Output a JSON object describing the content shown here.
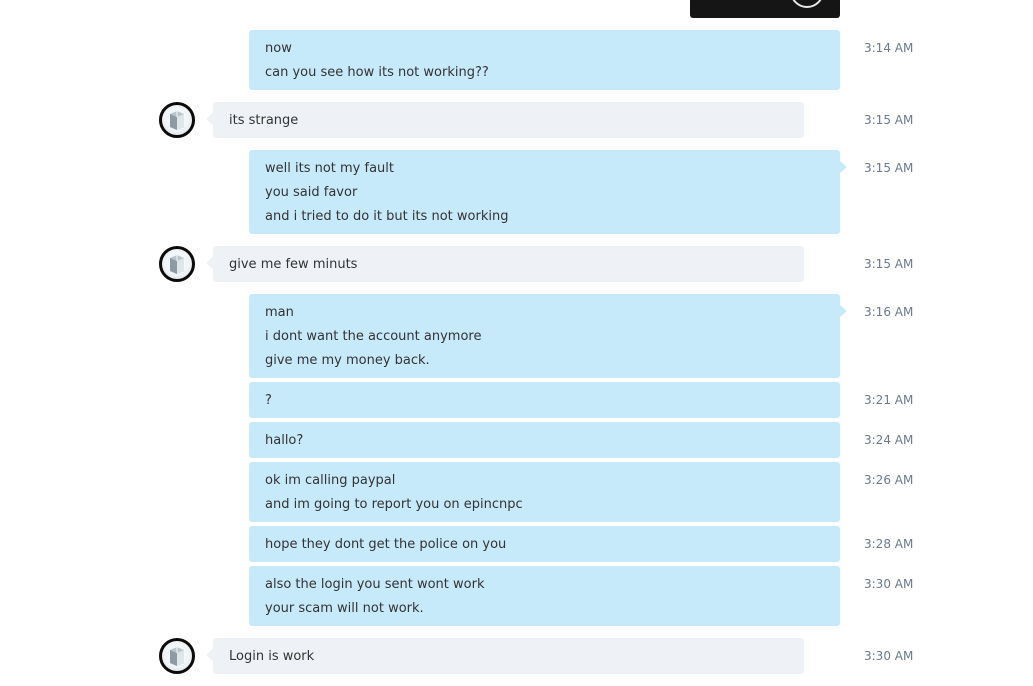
{
  "messages": [
    {
      "id": "m1",
      "direction": "out",
      "lines": [
        "now",
        "can you see how its not working??"
      ],
      "time": "3:14 AM"
    },
    {
      "id": "m2",
      "direction": "in",
      "lines": [
        "its strange"
      ],
      "time": "3:15 AM"
    },
    {
      "id": "m3",
      "direction": "out",
      "lines": [
        "well its not my fault",
        "you said favor",
        "and i tried to do it but its not working"
      ],
      "time": "3:15 AM"
    },
    {
      "id": "m4",
      "direction": "in",
      "lines": [
        "give me few minuts"
      ],
      "time": "3:15 AM"
    },
    {
      "id": "m5",
      "direction": "out",
      "lines": [
        "man",
        "i dont want the account anymore",
        "give me my money back."
      ],
      "time": "3:16 AM"
    },
    {
      "id": "m6",
      "direction": "out",
      "lines": [
        "?"
      ],
      "time": "3:21 AM"
    },
    {
      "id": "m7",
      "direction": "out",
      "lines": [
        "hallo?"
      ],
      "time": "3:24 AM"
    },
    {
      "id": "m8",
      "direction": "out",
      "lines": [
        "ok im calling paypal",
        "and im going to report you on epincnpc"
      ],
      "time": "3:26 AM"
    },
    {
      "id": "m9",
      "direction": "out",
      "lines": [
        "hope they dont get the police on you"
      ],
      "time": "3:28 AM"
    },
    {
      "id": "m10",
      "direction": "out",
      "lines": [
        "also the login you sent wont work",
        "your scam will not work."
      ],
      "time": "3:30 AM"
    },
    {
      "id": "m11",
      "direction": "in",
      "lines": [
        "Login is work"
      ],
      "time": "3:30 AM"
    }
  ]
}
